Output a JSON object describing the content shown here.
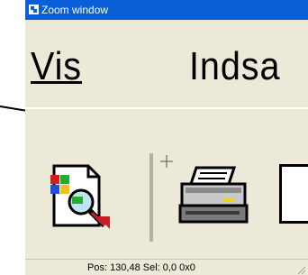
{
  "window": {
    "title": "Zoom window"
  },
  "menu": {
    "items": [
      {
        "label": "Vis"
      },
      {
        "label": "Indsa"
      }
    ]
  },
  "toolbar": {
    "icons": [
      "print-preview-icon",
      "printer-icon",
      "blank-document-icon"
    ]
  },
  "statusbar": {
    "text": "Pos: 130,48  Sel: 0,0 0x0"
  },
  "colors": {
    "titlebar": "#0a5fd8",
    "window_bg": "#ece9d8"
  }
}
